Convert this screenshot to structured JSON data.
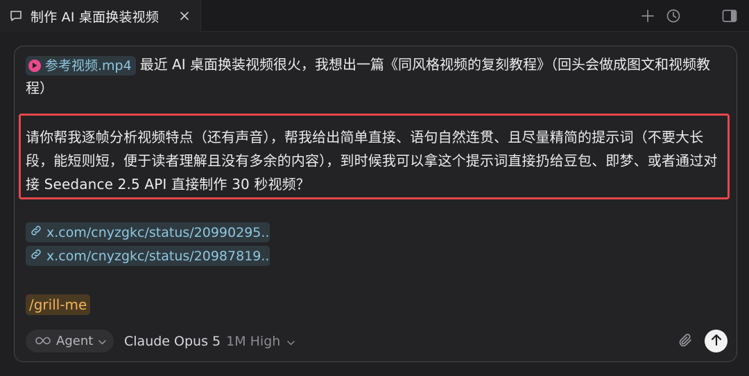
{
  "tab": {
    "title": "制作 AI 桌面换装视频",
    "icons": {
      "tab": "chat-bubble-icon",
      "close": "close-icon"
    }
  },
  "top_actions": {
    "icons": [
      "plus-icon",
      "history-clock-icon",
      "sidebar-toggle-icon"
    ]
  },
  "message": {
    "file_chip": "参考视频.mp4",
    "intro_text": "最近 AI 桌面换装视频很火，我想出一篇《同风格视频的复刻教程》（回头会做成图文和视频教程）",
    "highlighted_text": "请你帮我逐帧分析视频特点（还有声音），帮我给出简单直接、语句自然连贯、且尽量精简的提示词（不要大长段，能短则短，便于读者理解且没有多余的内容），到时候我可以拿这个提示词直接扔给豆包、即梦、或者通过对接 Seedance 2.5 API 直接制作 30 秒视频？",
    "links": [
      "x.com/cnyzgkc/status/20990295...",
      "x.com/cnyzgkc/status/20987819..."
    ],
    "command": "/grill-me"
  },
  "toolbar": {
    "agent_label": "Agent",
    "model_name": "Claude Opus 5",
    "model_variant": "1M High"
  },
  "colors": {
    "highlight_border": "#e8474b",
    "chip_text": "#8ec7e0",
    "command_text": "#f1b35a",
    "file_icon": "#e84a8a"
  }
}
